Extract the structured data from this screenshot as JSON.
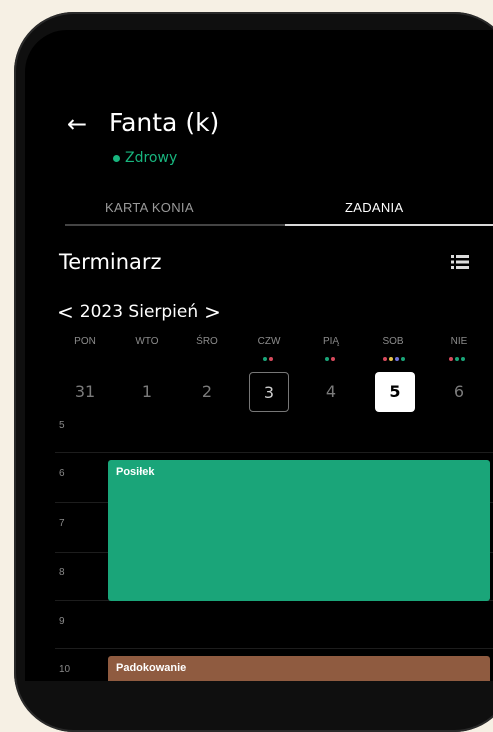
{
  "header": {
    "title": "Fanta (k)",
    "status": "Zdrowy",
    "status_color": "#18b57e"
  },
  "tabs": [
    {
      "label": "KARTA KONIA",
      "active": false
    },
    {
      "label": "ZADANIA",
      "active": true
    }
  ],
  "schedule": {
    "title": "Terminarz",
    "month_label": "2023 Sierpień",
    "days": [
      {
        "name": "PON",
        "number": "31",
        "dots": []
      },
      {
        "name": "WTO",
        "number": "1",
        "dots": []
      },
      {
        "name": "ŚRO",
        "number": "2",
        "dots": []
      },
      {
        "name": "CZW",
        "number": "3",
        "dots": [
          "#1aa579",
          "#d64a5c"
        ],
        "today": true
      },
      {
        "name": "PIĄ",
        "number": "4",
        "dots": [
          "#1aa579",
          "#d64a5c"
        ]
      },
      {
        "name": "SOB",
        "number": "5",
        "dots": [
          "#d64a5c",
          "#e6c34b",
          "#6f73d9",
          "#1aa579"
        ],
        "selected": true
      },
      {
        "name": "NIE",
        "number": "6",
        "dots": [
          "#d64a5c",
          "#1aa579",
          "#1aa579"
        ]
      }
    ],
    "hours": [
      "5",
      "6",
      "7",
      "8",
      "9",
      "10"
    ],
    "events": [
      {
        "label": "Posiłek",
        "color": "#1aa579"
      },
      {
        "label": "Padokowanie",
        "color": "#8f5b40"
      }
    ]
  }
}
